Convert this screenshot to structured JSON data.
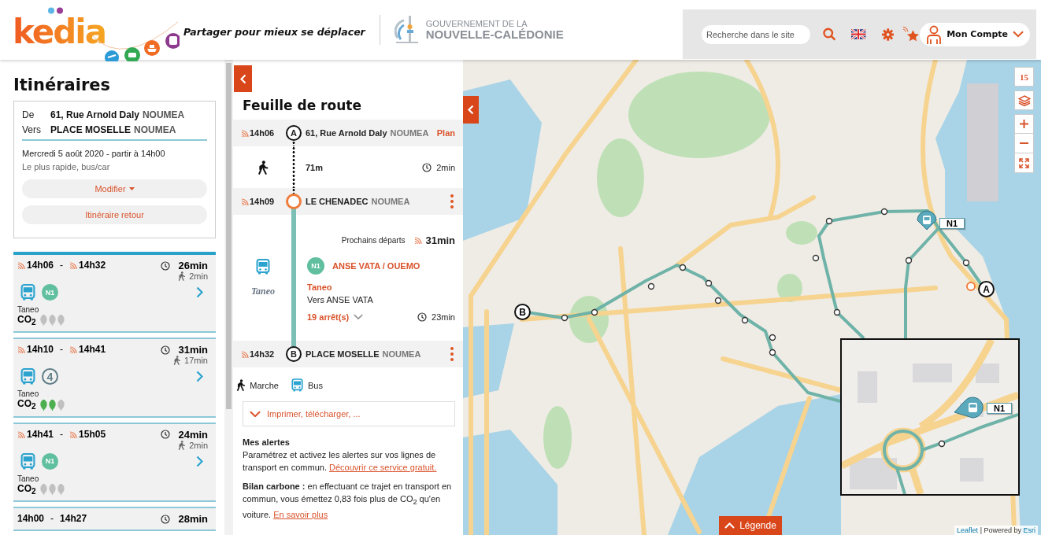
{
  "header": {
    "logo": "kedia",
    "tagline": "Partager pour mieux se déplacer",
    "government": [
      "GOUVERNEMENT DE LA",
      "NOUVELLE-CALÉDONIE"
    ],
    "search": {
      "placeholder": "Recherche dans le site"
    },
    "account": "Mon Compte"
  },
  "itineraries": {
    "title": "Itinéraires",
    "summary": {
      "from_label": "De",
      "from_place": "61, Rue Arnold Daly",
      "from_city": "NOUMEA",
      "to_label": "Vers",
      "to_place": "PLACE MOSELLE",
      "to_city": "NOUMEA",
      "date": "Mercredi 5 août 2020 -  partir à 14h00",
      "preference": "Le plus rapide, bus/car",
      "buttons": [
        "Modifier",
        "Itinéraire retour"
      ]
    },
    "results": [
      {
        "selected": true,
        "realtime": true,
        "departure": "14h06",
        "separator": "-",
        "arrival": "14h32",
        "duration": "26min",
        "walk": "2min",
        "line": {
          "kind": "badge",
          "label": "N1"
        },
        "operator": "Taneo",
        "co2_label": "CO$_{2}$",
        "stars": 0
      },
      {
        "selected": false,
        "realtime": true,
        "departure": "14h10",
        "separator": "-",
        "arrival": "14h41",
        "duration": "31min",
        "walk": "17min",
        "line": {
          "kind": "ring",
          "label": "4"
        },
        "operator": "Taneo",
        "co2_label": "CO$_{2}$",
        "stars": 2
      },
      {
        "selected": false,
        "realtime": true,
        "departure": "14h41",
        "separator": "-",
        "arrival": "15h05",
        "duration": "24min",
        "walk": "2min",
        "line": {
          "kind": "badge",
          "label": "N1"
        },
        "operator": "Taneo",
        "co2_label": "CO$_{2}$",
        "stars": 0
      },
      {
        "selected": false,
        "realtime": false,
        "departure": "14h00",
        "separator": "-",
        "arrival": "14h27",
        "duration": "28min"
      }
    ]
  },
  "roadmap": {
    "title": "Feuille de route",
    "steps": [
      {
        "kind": "stop",
        "realtime": true,
        "time": "14h06",
        "marker": "A",
        "place": "61, Rue Arnold Daly",
        "city": "NOUMEA",
        "action": "Plan"
      },
      {
        "kind": "walk",
        "distance": "71m",
        "duration": "2min"
      },
      {
        "kind": "stop",
        "realtime": true,
        "time": "14h09",
        "place": "LE CHENADEC",
        "city": "NOUMEA"
      },
      {
        "kind": "bus",
        "next_label": "Prochains départs",
        "next_time": "31min",
        "line": "N1",
        "direction": "ANSE VATA / OUEMO",
        "operator_logo": "Taneo",
        "operator": "Taneo",
        "headsign": "Vers ANSE VATA",
        "stops": "19 arrêt(s)",
        "duration": "23min"
      },
      {
        "kind": "stop",
        "realtime": true,
        "time": "14h32",
        "marker": "B",
        "place": "PLACE MOSELLE",
        "city": "NOUMEA"
      }
    ],
    "legend": [
      {
        "kind": "walk",
        "label": "Marche"
      },
      {
        "kind": "bus",
        "label": "Bus"
      }
    ],
    "print": "Imprimer, télécharger, ...",
    "alerts": {
      "title": "Mes alertes",
      "text": "Paramétrez et activez les alertes sur vos lignes de transport en commun. ",
      "link": "Découvrir ce service gratuit."
    },
    "carbon": {
      "text": "**Bilan carbone :** en effectuant ce trajet en transport en commun, vous émettez 0,83 fois plus de CO$_{2}$ qu'en voiture. ",
      "link": "En savoir plus"
    }
  },
  "map": {
    "zoom": "15",
    "markers": [
      {
        "label": "B"
      },
      {
        "label": "A"
      }
    ],
    "vehicle_label": "N1",
    "inset_vehicle_label": "N1",
    "legend_button": "Légende",
    "attribution": {
      "link": "Leaflet",
      "text": " | Powered by ",
      "provider": "Esri"
    }
  }
}
